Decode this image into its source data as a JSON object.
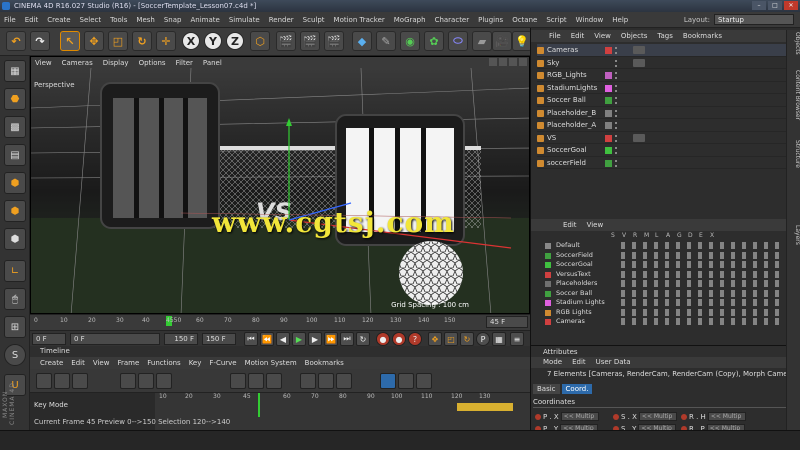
{
  "window": {
    "title": "CINEMA 4D R16.027 Studio (R16) - [SoccerTemplate_Lesson07.c4d *]",
    "min": "–",
    "max": "□",
    "close": "✕"
  },
  "menubar": [
    "File",
    "Edit",
    "Create",
    "Select",
    "Tools",
    "Mesh",
    "Snap",
    "Animate",
    "Simulate",
    "Render",
    "Sculpt",
    "Motion Tracker",
    "MoGraph",
    "Character",
    "Plugins",
    "Octane",
    "Script",
    "Window",
    "Help"
  ],
  "layout": {
    "label": "Layout:",
    "value": "Startup"
  },
  "toolbar": {
    "x": "X",
    "y": "Y",
    "z": "Z"
  },
  "viewport": {
    "menu": [
      "View",
      "Cameras",
      "Display",
      "Options",
      "Filter",
      "Panel"
    ],
    "label": "Perspective",
    "grid_spacing": "Grid Spacing : 100 cm",
    "watermark": "www.cgtsj.com",
    "vs_text": "VS"
  },
  "timeline_ruler": {
    "ticks": [
      "0",
      "10",
      "20",
      "30",
      "40",
      "4550",
      "60",
      "70",
      "80",
      "90",
      "100",
      "110",
      "120",
      "130",
      "140",
      "150"
    ],
    "end_frame": "45 F"
  },
  "play_controls": {
    "start": "0 F",
    "current": "0 F",
    "max": "150 F",
    "end": "150 F"
  },
  "timeline": {
    "title": "Timeline",
    "menu": [
      "Create",
      "Edit",
      "View",
      "Frame",
      "Functions",
      "Key",
      "F-Curve",
      "Motion System",
      "Bookmarks"
    ],
    "key_mode": "Key Mode",
    "ticks": [
      "10",
      "20",
      "30",
      "45",
      "60",
      "70",
      "80",
      "90",
      "100",
      "110",
      "120",
      "130"
    ],
    "status": "Current Frame  45   Preview  0-->150    Selection 120-->140"
  },
  "maxon_label": "MAXON CINEMA 4D",
  "objects": {
    "menu": [
      "File",
      "Edit",
      "View",
      "Objects",
      "Tags",
      "Bookmarks"
    ],
    "items": [
      {
        "name": "Cameras",
        "swatch": "#d04040"
      },
      {
        "name": "Sky",
        "swatch": ""
      },
      {
        "name": "RGB_Lights",
        "swatch": "#c060c0"
      },
      {
        "name": "StadiumLights",
        "swatch": "#e060e0"
      },
      {
        "name": "Soccer Ball",
        "swatch": "#40a040"
      },
      {
        "name": "Placeholder_B",
        "swatch": "#808080"
      },
      {
        "name": "Placeholder_A",
        "swatch": "#808080"
      },
      {
        "name": "VS",
        "swatch": "#d04040"
      },
      {
        "name": "SoccerGoal",
        "swatch": "#40c040"
      },
      {
        "name": "soccerField",
        "swatch": "#40a040"
      }
    ]
  },
  "side_tabs": [
    "Objects",
    "Content Browser",
    "Structure",
    "Layers"
  ],
  "layers": {
    "menu": [
      "Edit",
      "View"
    ],
    "headers": [
      "S",
      "V",
      "R",
      "M",
      "L",
      "A",
      "G",
      "D",
      "E",
      "X"
    ],
    "items": [
      {
        "name": "Default",
        "color": "#888888"
      },
      {
        "name": "SoccerField",
        "color": "#40a040"
      },
      {
        "name": "SoccerGoal",
        "color": "#40c040"
      },
      {
        "name": "VersusText",
        "color": "#d04040"
      },
      {
        "name": "Placeholders",
        "color": "#707070"
      },
      {
        "name": "Soccer Ball",
        "color": "#40a040"
      },
      {
        "name": "Stadium Lights",
        "color": "#e060e0"
      },
      {
        "name": "RGB Lights",
        "color": "#d08a30"
      },
      {
        "name": "Cameras",
        "color": "#d04040"
      }
    ]
  },
  "attributes": {
    "title": "Attributes",
    "menu": [
      "Mode",
      "Edit",
      "User Data"
    ],
    "selection": "7 Elements [Cameras, RenderCam, RenderCam (Copy), Morph Camera, Camera_",
    "tabs": [
      "Basic",
      "Coord."
    ],
    "section": "Coordinates",
    "rows": [
      {
        "a": "P . X",
        "av": "<< Multip",
        "b": "S . X",
        "bv": "<< Multip",
        "c": "R . H",
        "cv": "<< Multip"
      },
      {
        "a": "P . Y",
        "av": "<< Multip",
        "b": "S . Y",
        "bv": "<< Multip",
        "c": "R . P",
        "cv": "<< Multip"
      },
      {
        "a": "P . Z",
        "av": "<< Multip",
        "b": "S . Z",
        "bv": "<< Multip",
        "c": "R . B",
        "cv": "<< Multip"
      }
    ]
  },
  "colors": {
    "accent": "#e08a00",
    "selection": "#2d6aaa",
    "watermark": "#f2e63a"
  }
}
